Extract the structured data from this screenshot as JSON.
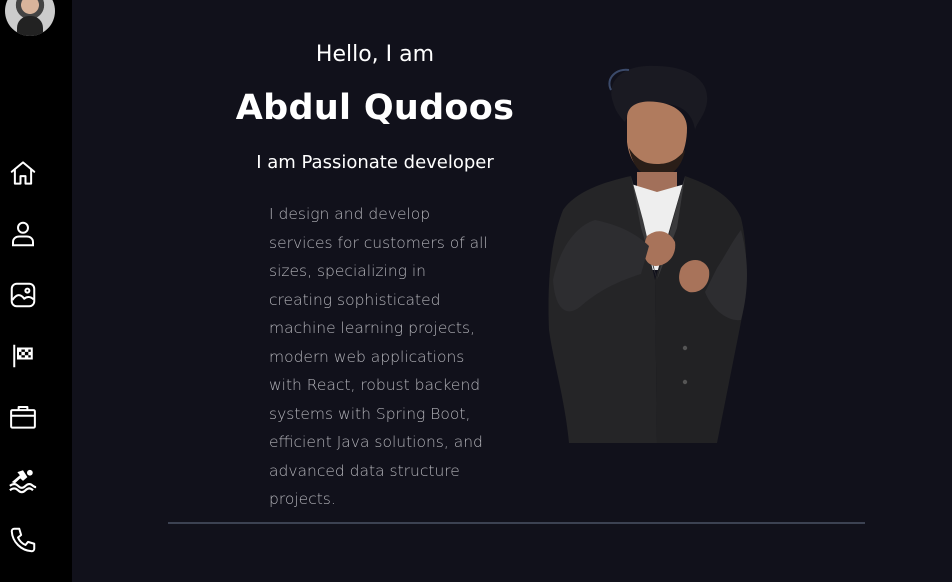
{
  "sidebar": {
    "items": [
      {
        "name": "home",
        "icon": "home-icon"
      },
      {
        "name": "about",
        "icon": "person-icon"
      },
      {
        "name": "portfolio",
        "icon": "image-icon"
      },
      {
        "name": "goals",
        "icon": "flag-icon"
      },
      {
        "name": "work",
        "icon": "briefcase-icon"
      },
      {
        "name": "hobbies",
        "icon": "swimmer-icon"
      },
      {
        "name": "contact",
        "icon": "phone-icon"
      }
    ]
  },
  "hero": {
    "greeting": "Hello, I am",
    "name": "Abdul Qudoos",
    "tagline": "I am Passionate developer",
    "description": "I design and develop services for customers of all sizes, specializing in creating sophisticated machine learning projects, modern web applications with React, robust backend systems with Spring Boot, efficient Java solutions, and advanced data structure projects."
  },
  "colors": {
    "background": "#11111b",
    "sidebar": "#000000",
    "text": "#ffffff",
    "muted_text": "#b2b2b8",
    "divider": "#3c4252"
  }
}
